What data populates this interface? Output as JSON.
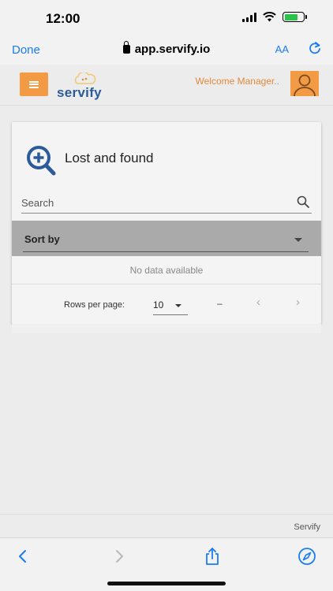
{
  "status_bar": {
    "time": "12:00"
  },
  "browser": {
    "done_label": "Done",
    "url": "app.servify.io",
    "text_size_label": "AA"
  },
  "header": {
    "logo_text": "servify",
    "welcome_text": "Welcome Manager.."
  },
  "card": {
    "title": "Lost and found",
    "search_placeholder": "Search",
    "sort_label": "Sort by",
    "empty_message": "No data available",
    "rows_per_page_label": "Rows per page:",
    "rows_per_page_value": "10",
    "range_text": "–",
    "prev_label": "‹",
    "next_label": "›"
  },
  "footer": {
    "site_label": "Servify"
  },
  "colors": {
    "accent": "#f29a44",
    "brand_blue": "#2d5b9a",
    "ios_blue": "#1a7cf5"
  },
  "icons": [
    "lock-icon",
    "reload-icon",
    "menu-icon",
    "avatar-icon",
    "zoom-in-icon",
    "search-icon",
    "back-icon",
    "forward-icon",
    "share-icon",
    "compass-icon"
  ]
}
